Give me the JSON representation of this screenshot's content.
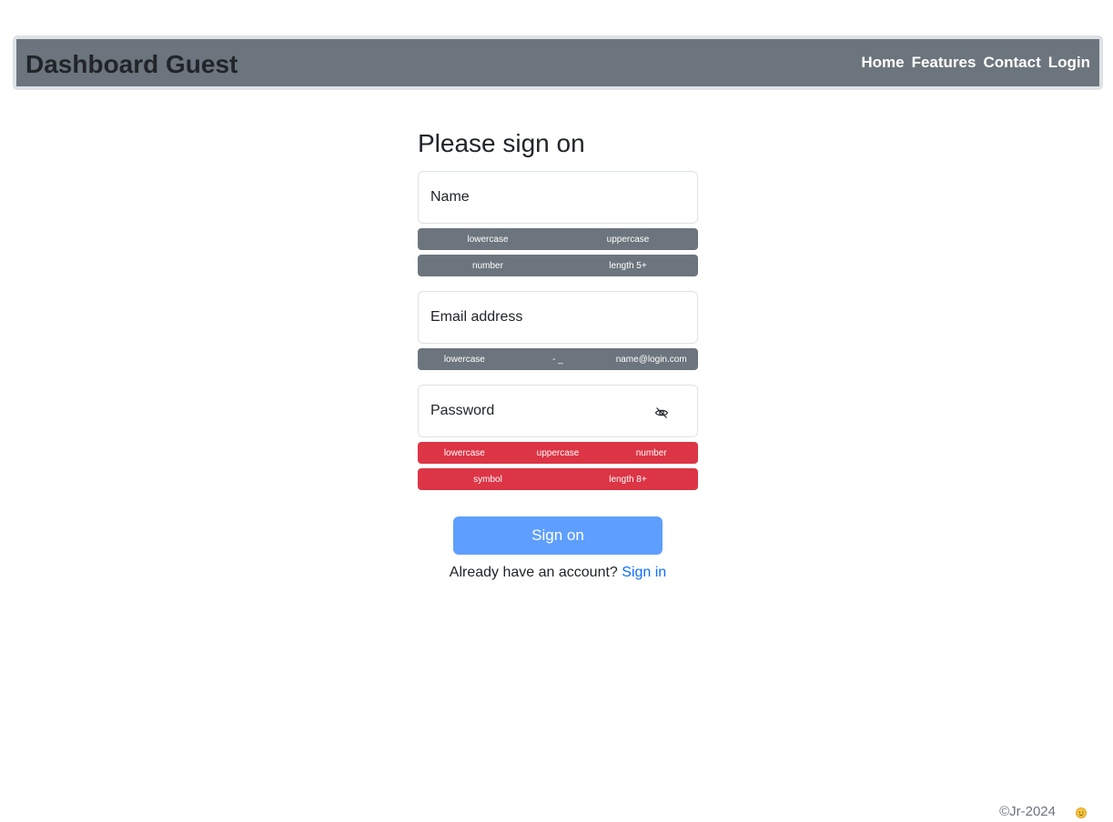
{
  "navbar": {
    "brand": "Dashboard Guest",
    "links": [
      "Home",
      "Features",
      "Contact",
      "Login"
    ]
  },
  "form": {
    "title": "Please sign on",
    "name_placeholder": "Name",
    "name_rules_row1": [
      "lowercase",
      "uppercase"
    ],
    "name_rules_row2": [
      "number",
      "length 5+"
    ],
    "email_placeholder": "Email address",
    "email_rules": [
      "lowercase",
      "- _",
      "name@login.com"
    ],
    "password_placeholder": "Password",
    "password_rules_row1": [
      "lowercase",
      "uppercase",
      "number"
    ],
    "password_rules_row2": [
      "symbol",
      "length 8+"
    ],
    "password_toggle_icon": "eye-slash-icon",
    "submit_label": "Sign on",
    "account_prompt": "Already have an account?",
    "signin_link": "Sign in"
  },
  "footer": {
    "copyright": "©Jr-2024",
    "theme_icon": "sun-icon"
  },
  "colors": {
    "navbar_bg": "#6c757d",
    "navbar_border": "#dee2e6",
    "rule_neutral": "#6c757d",
    "rule_invalid": "#dc3545",
    "submit_bg": "#5e9ffd",
    "link": "#0d6efd"
  }
}
